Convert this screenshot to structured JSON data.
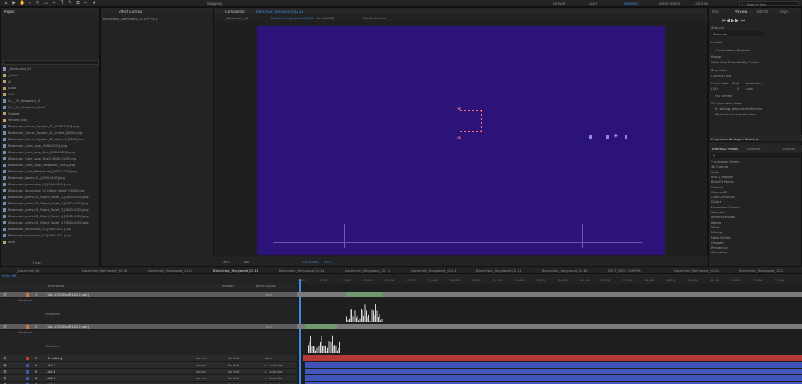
{
  "toolbar": {
    "tools": [
      "⌂",
      "▶",
      "✋",
      "⌕",
      "⟳",
      "▭",
      "✒",
      "T",
      "✎",
      "⧉",
      "✂",
      "★"
    ],
    "snapping": "Snapping",
    "workspaces": [
      "Default",
      "Learn",
      "Standard",
      "Small Screen",
      "Libraries"
    ],
    "active_workspace": "Standard",
    "search_placeholder": "Search Help"
  },
  "project_panel": {
    "title": "Project",
    "items": [
      {
        "label": "_Blankframe_V4",
        "kind": "comp"
      },
      {
        "label": "_Assets",
        "kind": "folder"
      },
      {
        "label": "AI",
        "kind": "folder"
      },
      {
        "label": "Audio",
        "kind": "folder"
      },
      {
        "label": "LAG",
        "kind": "folder"
      },
      {
        "label": "L1_1_Fx_Hesapxxxl_XL",
        "kind": "file"
      },
      {
        "label": "L2_1_Fx_Hesapxxxl_XLdd",
        "kind": "file"
      },
      {
        "label": "Footage",
        "kind": "folder"
      },
      {
        "label": "Renders (AW)",
        "kind": "folder"
      },
      {
        "label": "Blockchain_Course_Topcher_01_[0000-0100].png",
        "kind": "file"
      },
      {
        "label": "Blockchain_Course_Topcher_01_Aruline_[0000].png",
        "kind": "file"
      },
      {
        "label": "Blockchain_Course_Topcher_01_object_1_[0000].png",
        "kind": "file"
      },
      {
        "label": "Blockchain_Cube_Loop_[0000-0100].png",
        "kind": "file"
      },
      {
        "label": "Blockchain_Cube_Loop_Blue_[0000-0100].png",
        "kind": "file"
      },
      {
        "label": "Blockchain_Cube_Loop_Blue2_[0000-0100].png",
        "kind": "file"
      },
      {
        "label": "Blockchain_Cube_Loop_Halfphone_[0000].png",
        "kind": "file"
      },
      {
        "label": "Blockchain_Cube_Metasquare_[0000-0100].png",
        "kind": "file"
      },
      {
        "label": "Blockchain_Nodes_AL_[0000-0100].png",
        "kind": "file"
      },
      {
        "label": "Blockchain_Launchsite_01_[0000-0011].png",
        "kind": "file"
      },
      {
        "label": "Blockchain_Launchsite_01_Object_Bokeh_[0000].png",
        "kind": "file"
      },
      {
        "label": "Blockchain_prefix_01_Object_Bokeh_1_[0000-0011].png",
        "kind": "file"
      },
      {
        "label": "Blockchain_prefix_01_Object_Bokeh_2_[0000-0011].png",
        "kind": "file"
      },
      {
        "label": "Blockchain_prefix_01_Object_Bokeh_3_[0000-0011].png",
        "kind": "file"
      },
      {
        "label": "Blockchain_prefix_01_Object_Bokeh_4_[0000-0011].png",
        "kind": "file"
      },
      {
        "label": "Blockchain_prefix_01_Object_Bokeh_5_[0000-0011].png",
        "kind": "file"
      },
      {
        "label": "Blockchain_Launchsite_01_[0000-0011].png",
        "kind": "file"
      },
      {
        "label": "Blockchain_Launchsite_02_[0000-0011].png",
        "kind": "file"
      },
      {
        "label": "Solid",
        "kind": "folder"
      }
    ],
    "footer": "8 bpc"
  },
  "effect_controls": {
    "title": "Effect Controls",
    "subtitle": "Blockchain_Storyboard_01-14 • 01.1"
  },
  "composition": {
    "title": "Composition",
    "comp_name": "Blockchain_Storyboard_02.14",
    "tabs": [
      "_Blockchain_V4",
      "Blockchain_Storyboard_02.14",
      "Red Bolt 02",
      "Objects & Texts"
    ],
    "footer": {
      "zoom": "25%",
      "quality": "Full",
      "timecode": "0;00;02;06",
      "color": "+0.0"
    }
  },
  "right_panel": {
    "tabs": [
      "Info",
      "Preview",
      "Effects",
      "Align"
    ],
    "active_tab": "Preview",
    "shortcut_label": "Shortcut",
    "shortcut_value": "Spacebar",
    "include_label": "Include:",
    "cache_label": "Cache Before Playback",
    "range_label": "Range",
    "range_value": "Work Area Extended By Current...",
    "play_from_label": "Play From",
    "play_from_value": "Current Time",
    "frame_rate_label": "Frame Rate",
    "skip_label": "Skip",
    "resolution_label": "Resolution",
    "frame_rate_value": "(30)",
    "skip_value": "0",
    "resolution_value": "Auto",
    "full_screen_label": "Full Screen",
    "on_stop_label": "On (Spacebar) Stop:",
    "if_caching_label": "If caching, play cached frames",
    "move_time_label": "Move time to preview time",
    "properties_title": "Properties: No Layers Selected",
    "effects_tabs": [
      "Effects & Presets",
      "Libraries",
      "Brushes"
    ],
    "effects_search": "ρ",
    "effect_categories": [
      "* Animation Presets",
      "3D Channel",
      "Audio",
      "Blur & Sharpen",
      "Boris FX Mocha",
      "Channel",
      "Cinema 4D",
      "Color Correction",
      "Distort",
      "Expression Controls",
      "Generate",
      "Immersive Video",
      "Keying",
      "Matte",
      "Missing",
      "Noise & Grain",
      "Obsolete",
      "Perspective",
      "Simulation"
    ]
  },
  "timeline": {
    "tabs": [
      "_Blockchain_V4",
      "Blockchain_Storyboard_01-06",
      "Blockchain_Storyboard_01-10",
      "Blockchain_Storyboard_01-13",
      "Blockchain_Storyboard_01-14",
      "Blockchain_Storyboard_02-11",
      "Blockchain_Storyboard_02-13",
      "Blockchain_Storyboard_02-14",
      "Blockchain_Storyboard_02-16",
      "SHOT_05.01 CAMERA",
      "Blockchain_Storyboard_02-20",
      "Blockchain_Storyboard_02-21"
    ],
    "timecode": "0;00;00",
    "columns": {
      "layer_name": "Layer Name",
      "trk_matte": "TrkMatte",
      "parent": "Parent & Link"
    },
    "ruler": [
      "0;00",
      "0;15f",
      "01;00f",
      "01;15f",
      "02;00f",
      "02;15f",
      "03;00f",
      "03;15f",
      "04;00f",
      "04;15f",
      "05;00f",
      "05;15f",
      "06;00f",
      "06;15f",
      "07;00f",
      "07;15f",
      "08;00f",
      "08;15f",
      "09;00f",
      "09;15f",
      "10;00f",
      "10;15f",
      "11;00f"
    ],
    "layers": [
      {
        "num": "1",
        "name": "[VAL 8.OOCHAIR 1AG 2.wav]",
        "parent": "None",
        "kind": "audio"
      },
      {
        "num": "2",
        "name": "[VAL 8.OOCHAIR 1AG 2.wav]",
        "parent": "None",
        "kind": "audio"
      },
      {
        "num": "3",
        "name": "[1.motion]",
        "mode": "Normal",
        "matte": "No Matt",
        "parent": "None"
      },
      {
        "num": "4",
        "name": "LAG 7",
        "mode": "Normal",
        "matte": "No Matt",
        "parent": "2. Controller"
      },
      {
        "num": "5",
        "name": "LAG 6",
        "mode": "Normal",
        "matte": "No Matt",
        "parent": "2. Controller"
      },
      {
        "num": "6",
        "name": "LAG 5",
        "mode": "Normal",
        "matte": "No Matt",
        "parent": "2. Controller"
      },
      {
        "num": "7",
        "name": "LAG 4",
        "mode": "Normal",
        "matte": "No Matt",
        "parent": "2. Controller"
      }
    ],
    "waveform_label": "Waveform",
    "audio_label": "Waveform"
  },
  "colors": {
    "accent": "#3d8de0",
    "viewer_bg": "#2b137a",
    "audio_bar": "#8a8a8a",
    "audio_clip": "#5f8f5f",
    "red_bar": "#b33a3a",
    "blue_bar": "#3f53b8"
  }
}
